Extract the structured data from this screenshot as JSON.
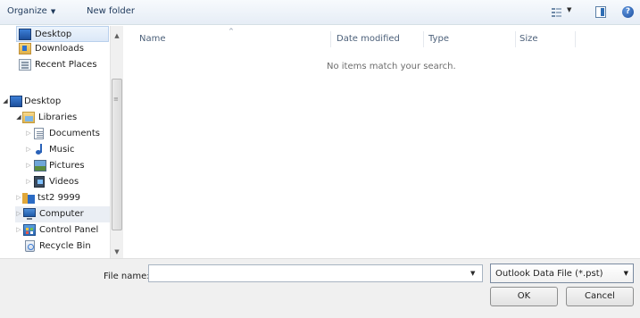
{
  "toolbar": {
    "organize_label": "Organize",
    "new_folder_label": "New folder"
  },
  "nav": {
    "favorites": [
      {
        "label": "Desktop",
        "icon": "desktop-icon"
      },
      {
        "label": "Downloads",
        "icon": "downloads-folder-icon"
      },
      {
        "label": "Recent Places",
        "icon": "recent-places-icon"
      }
    ],
    "tree": [
      {
        "label": "Desktop",
        "icon": "desktop-icon",
        "expanded": true
      },
      {
        "label": "Libraries",
        "icon": "libraries-icon",
        "expanded": true
      },
      {
        "label": "Documents",
        "icon": "documents-icon"
      },
      {
        "label": "Music",
        "icon": "music-icon"
      },
      {
        "label": "Pictures",
        "icon": "pictures-icon"
      },
      {
        "label": "Videos",
        "icon": "videos-icon"
      },
      {
        "label": "tst2 9999",
        "icon": "user-folder-icon"
      },
      {
        "label": "Computer",
        "icon": "computer-icon"
      },
      {
        "label": "Control Panel",
        "icon": "control-panel-icon"
      },
      {
        "label": "Recycle Bin",
        "icon": "recycle-bin-icon"
      }
    ]
  },
  "columns": [
    "Name",
    "Date modified",
    "Type",
    "Size"
  ],
  "empty_message": "No items match your search.",
  "footer": {
    "file_name_label": "File name:",
    "file_name_value": "",
    "file_type_selected": "Outlook Data File (*.pst)",
    "ok_label": "OK",
    "cancel_label": "Cancel"
  },
  "colors": {
    "toolbar_text": "#1e395b",
    "selection_bg": "#dbe8f8",
    "bottom_panel": "#f0f0f0"
  }
}
